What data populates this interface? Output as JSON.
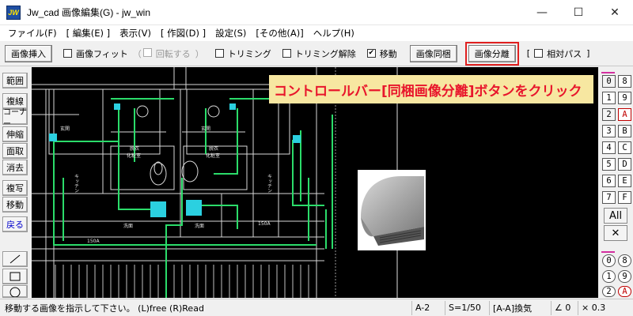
{
  "window": {
    "logo": "JW",
    "title": "Jw_cad 画像編集(G) - jw_win",
    "minimize": "—",
    "maximize": "☐",
    "close": "✕"
  },
  "menu": [
    "ファイル(F)",
    "[ 編集(E) ]",
    "表示(V)",
    "[ 作図(D) ]",
    "設定(S)",
    "[その他(A)]",
    "ヘルプ(H)"
  ],
  "toolbar": {
    "insert_image": "画像挿入",
    "fit_image": "画像フィット",
    "rotate_open": "（",
    "rotate": "回転する",
    "rotate_close": "）",
    "trimming": "トリミング",
    "trimming_cancel": "トリミング解除",
    "move": "移動",
    "move_checked": "✔",
    "bundle_image": "画像同梱",
    "split_image": "画像分離",
    "relative_path_open": "[",
    "relative_path": "相対パス",
    "relative_path_close": "]"
  },
  "left_tools": [
    "範囲",
    "複線",
    "コーナー",
    "伸縮",
    "面取",
    "消去",
    "複写",
    "移動",
    "戻る"
  ],
  "callout": "コントロールバー[同梱画像分離]ボタンをクリック",
  "right_panel": {
    "rows": [
      [
        "0",
        "8"
      ],
      [
        "1",
        "9"
      ],
      [
        "2",
        "A"
      ],
      [
        "3",
        "B"
      ],
      [
        "4",
        "C"
      ],
      [
        "5",
        "D"
      ],
      [
        "6",
        "E"
      ],
      [
        "7",
        "F"
      ]
    ],
    "all_label": "All",
    "x_label": "✕",
    "layer_rows": [
      [
        "0",
        "8"
      ],
      [
        "1",
        "9"
      ],
      [
        "2",
        "A"
      ]
    ]
  },
  "drawing_labels": {
    "genkan": "玄関",
    "datsui": "脱衣",
    "keshoshitsu": "化粧室",
    "washitsu": "洗面",
    "kitchen": "キッチン",
    "pipe": "150A"
  },
  "status": {
    "message": "移動する画像を指示して下さい。 (L)free  (R)Read",
    "sheet": "A-2",
    "scale": "S=1/50",
    "layer": "[A-A]換気",
    "angle": "∠ 0",
    "zoom": "× 0.3"
  }
}
